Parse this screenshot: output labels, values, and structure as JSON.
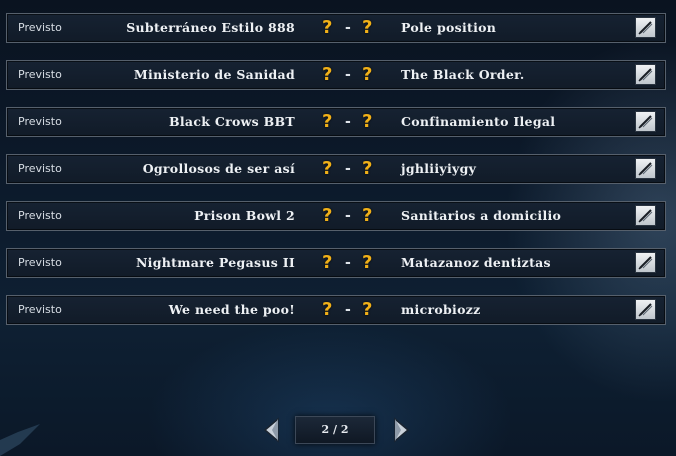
{
  "matches": [
    {
      "status": "Previsto",
      "home": "Subterráneo Estilo 888",
      "home_score": "?",
      "separator": "-",
      "away_score": "?",
      "away": "Pole position"
    },
    {
      "status": "Previsto",
      "home": "Ministerio de Sanidad",
      "home_score": "?",
      "separator": "-",
      "away_score": "?",
      "away": "The Black Order."
    },
    {
      "status": "Previsto",
      "home": "Black Crows BBT",
      "home_score": "?",
      "separator": "-",
      "away_score": "?",
      "away": "Confinamiento Ilegal"
    },
    {
      "status": "Previsto",
      "home": "Ogrollosos de ser así",
      "home_score": "?",
      "separator": "-",
      "away_score": "?",
      "away": "jghliiyiygy"
    },
    {
      "status": "Previsto",
      "home": "Prison Bowl 2",
      "home_score": "?",
      "separator": "-",
      "away_score": "?",
      "away": "Sanitarios a domicilio"
    },
    {
      "status": "Previsto",
      "home": "Nightmare Pegasus II",
      "home_score": "?",
      "separator": "-",
      "away_score": "?",
      "away": "Matazanoz dentiztas"
    },
    {
      "status": "Previsto",
      "home": "We need the poo!",
      "home_score": "?",
      "separator": "-",
      "away_score": "?",
      "away": "microbiozz"
    }
  ],
  "pagination": {
    "label": "2 / 2"
  },
  "icons": {
    "edit": "pencil-icon",
    "prev": "arrow-left-icon",
    "next": "arrow-right-icon"
  },
  "colors": {
    "score_unknown": "#f0b019"
  }
}
